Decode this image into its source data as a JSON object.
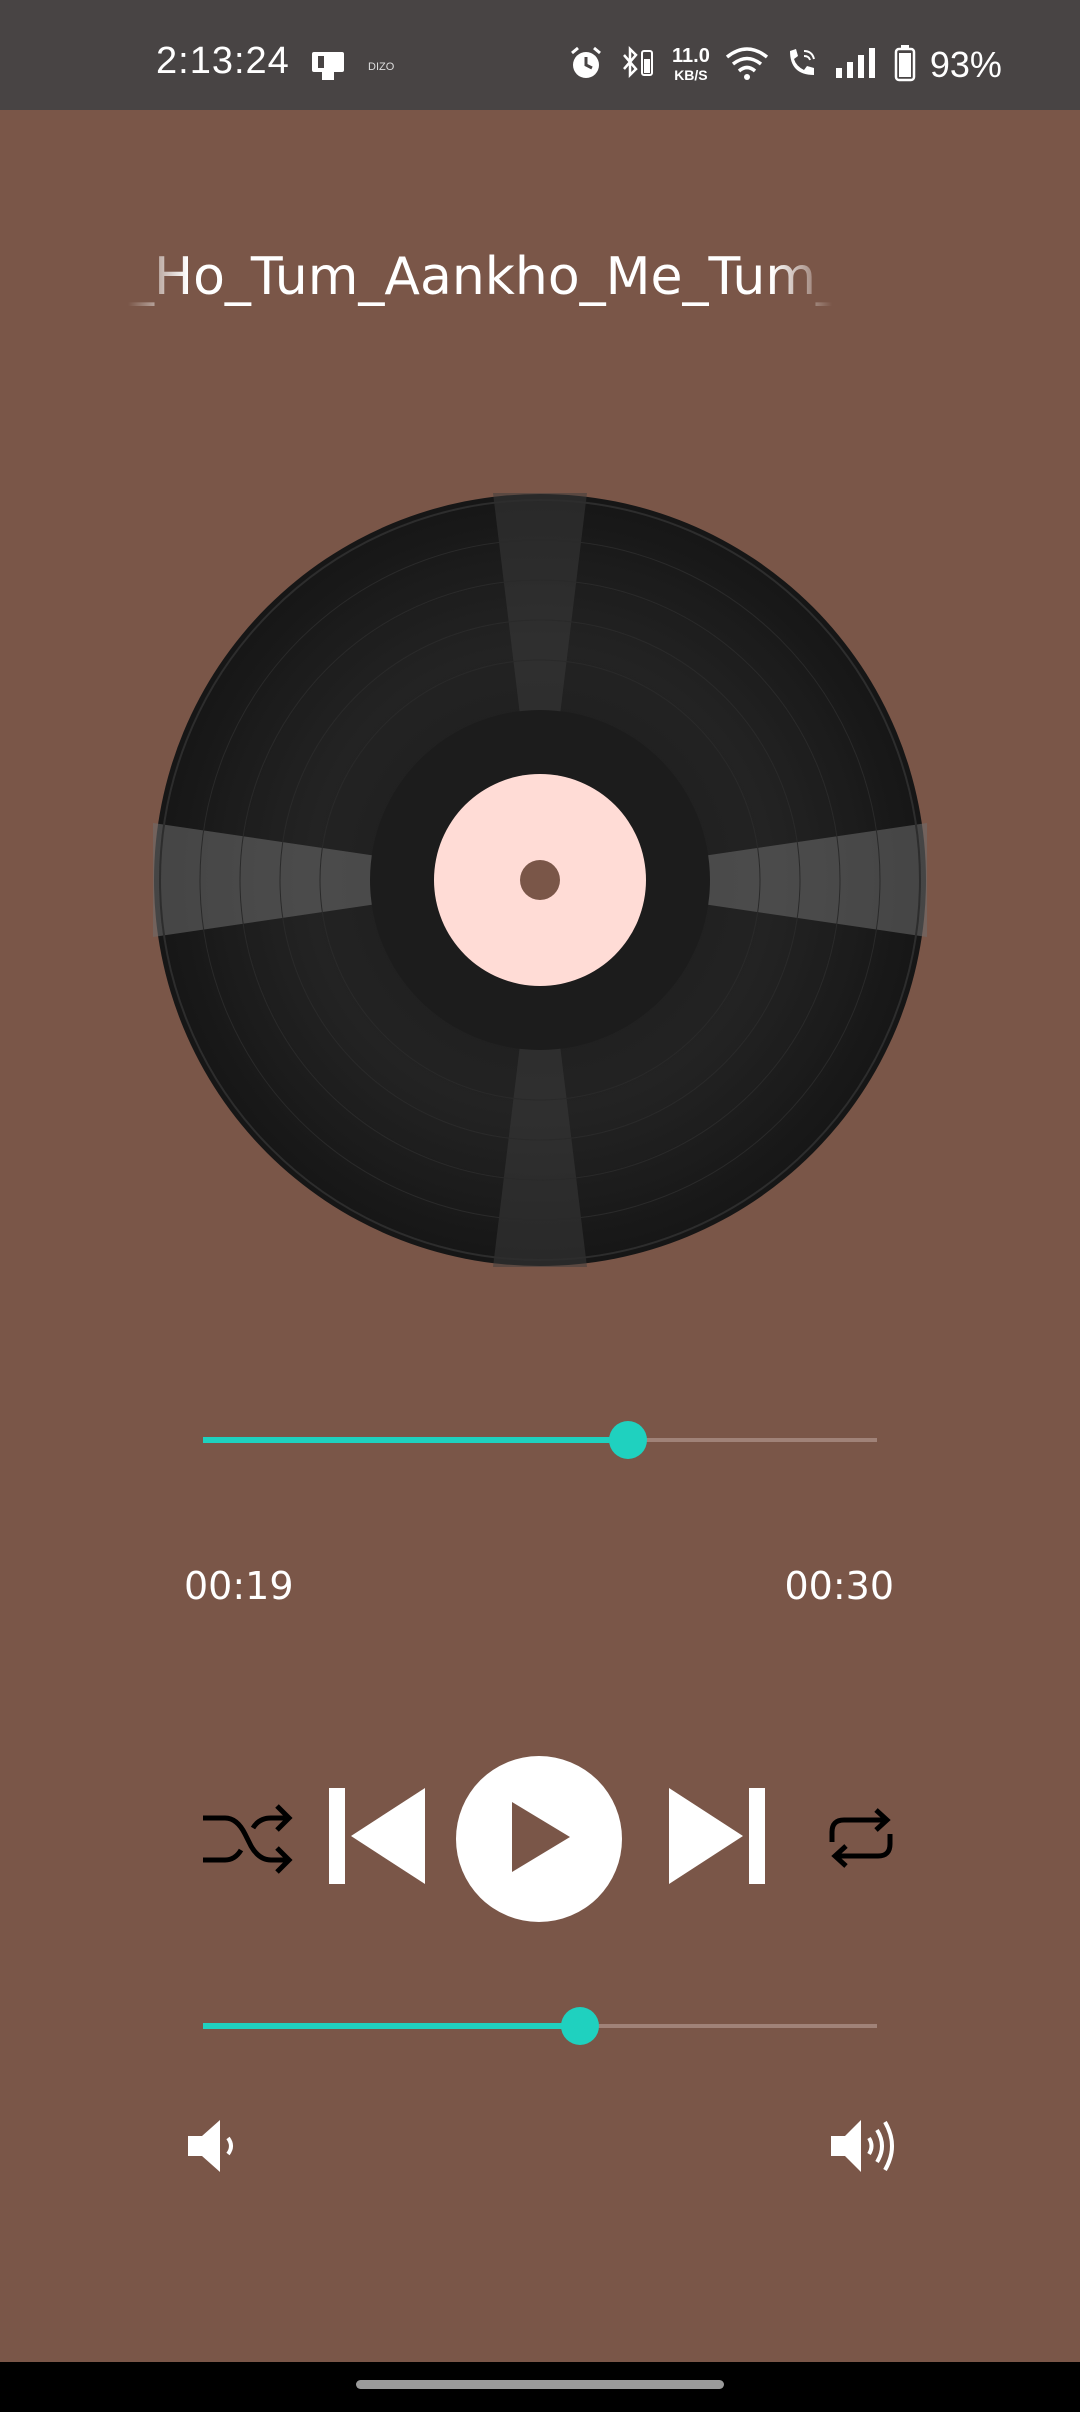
{
  "status_bar": {
    "time": "2:13:24",
    "brand_label": "DIZO",
    "net_speed_value": "11.0",
    "net_speed_unit": "KB/S",
    "battery_percent": "93%"
  },
  "player": {
    "song_title": "_Ho_Tum_Aankho_Me_Tum__",
    "elapsed_time": "00:19",
    "total_time": "00:30",
    "progress_fraction": 0.63,
    "volume_fraction": 0.56
  },
  "controls": {
    "shuffle_icon": "shuffle-icon",
    "previous_icon": "skip-previous-icon",
    "play_icon": "play-icon",
    "next_icon": "skip-next-icon",
    "repeat_icon": "repeat-icon",
    "volume_down_icon": "volume-low-icon",
    "volume_up_icon": "volume-high-icon"
  },
  "colors": {
    "background": "#7a5648",
    "status_bar": "#484444",
    "accent": "#1fd1bf",
    "record_label": "#ffdcd6",
    "record": "#1e1e1e"
  }
}
